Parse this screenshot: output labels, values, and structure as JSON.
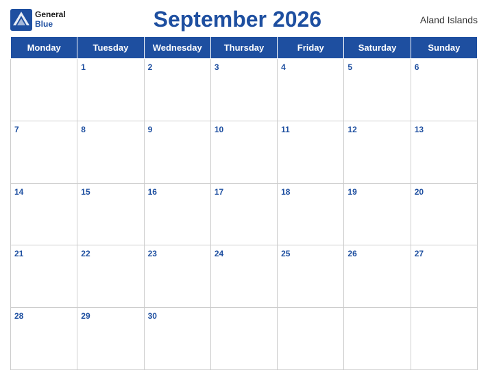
{
  "header": {
    "logo_general": "General",
    "logo_blue": "Blue",
    "title": "September 2026",
    "region": "Aland Islands"
  },
  "calendar": {
    "days_of_week": [
      "Monday",
      "Tuesday",
      "Wednesday",
      "Thursday",
      "Friday",
      "Saturday",
      "Sunday"
    ],
    "weeks": [
      [
        null,
        1,
        2,
        3,
        4,
        5,
        6
      ],
      [
        7,
        8,
        9,
        10,
        11,
        12,
        13
      ],
      [
        14,
        15,
        16,
        17,
        18,
        19,
        20
      ],
      [
        21,
        22,
        23,
        24,
        25,
        26,
        27
      ],
      [
        28,
        29,
        30,
        null,
        null,
        null,
        null
      ]
    ]
  }
}
